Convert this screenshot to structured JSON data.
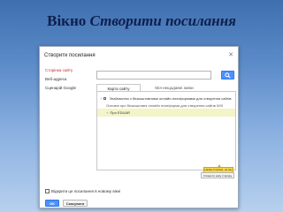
{
  "slide": {
    "title_plain": "Вікно ",
    "title_italic": "Створити посилання"
  },
  "dialog": {
    "title": "Створити посилання",
    "close_glyph": "✕",
    "sidebar": {
      "items": [
        {
          "label": "Сторінка сайту",
          "active": true
        },
        {
          "label": "Веб-адреса",
          "active": false
        },
        {
          "label": "Сценарій Google",
          "active": false
        }
      ]
    },
    "search": {
      "value": "",
      "placeholder": ""
    },
    "tabs": [
      {
        "label": "Карта сайту"
      },
      {
        "label": "Мої нещодавні зміни"
      }
    ],
    "tree": {
      "root": {
        "expander": "+",
        "label": "Знайомство з безкоштовними онлайн-платформами для створення сайтів"
      },
      "child": {
        "label": "Основні про безкоштовні онлайн платформи для створення сайтів WIX"
      },
      "selected": {
        "expander": "+",
        "label": "Про EDUAR"
      }
    },
    "callout_text": "Назва сторінки, на яку здійснюватиметься перехід",
    "create_new_page_label": "Створити нову сторінку",
    "open_new_window_label": "Відкрити це посилання в новому вікні",
    "ok_label": "OK",
    "cancel_label": "Скасувати"
  },
  "colors": {
    "accent": "#4d90fe",
    "active_nav": "#cc2b2b",
    "highlight_row": "#f3f4c8",
    "callout": "#f6d84a",
    "slide_title": "#0d1f4d"
  },
  "icons": {
    "search_button": "search-icon",
    "close": "close-icon"
  }
}
